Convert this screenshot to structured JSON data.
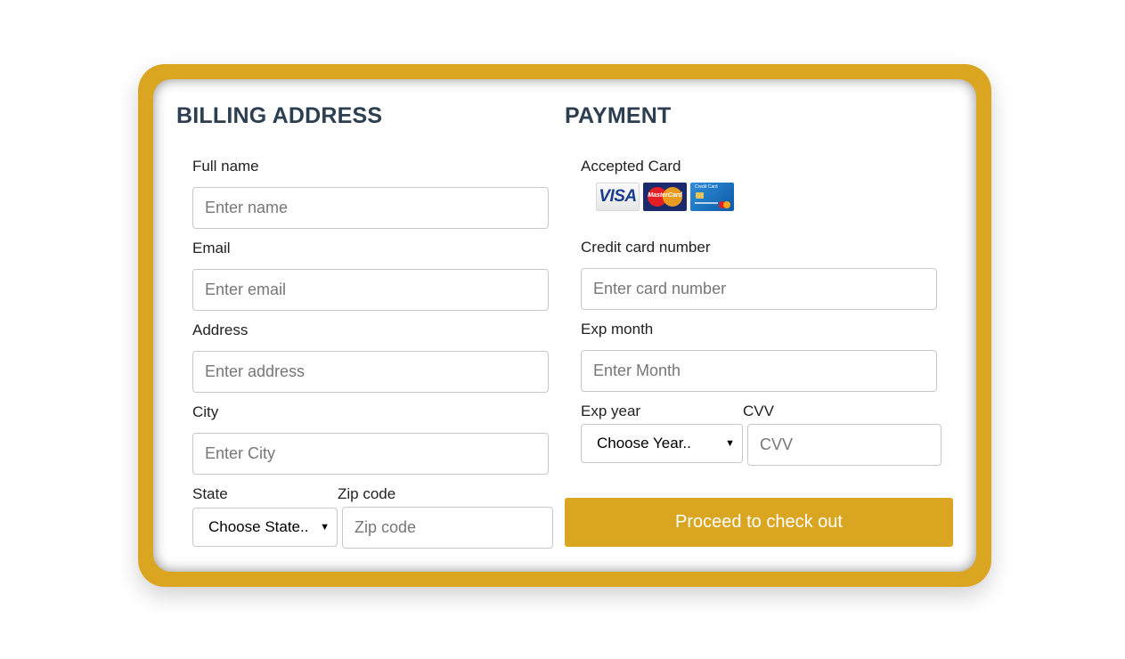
{
  "billing": {
    "heading": "BILLING ADDRESS",
    "full_name": {
      "label": "Full name",
      "placeholder": "Enter name",
      "value": ""
    },
    "email": {
      "label": "Email",
      "placeholder": "Enter email",
      "value": ""
    },
    "address": {
      "label": "Address",
      "placeholder": "Enter address",
      "value": ""
    },
    "city": {
      "label": "City",
      "placeholder": "Enter City",
      "value": ""
    },
    "state": {
      "label": "State",
      "selected": "Choose State.."
    },
    "zip": {
      "label": "Zip code",
      "placeholder": "Zip code",
      "value": ""
    }
  },
  "payment": {
    "heading": "PAYMENT",
    "accepted_label": "Accepted Card",
    "accepted_cards": [
      "visa-card-icon",
      "mastercard-icon",
      "generic-credit-card-icon"
    ],
    "visa_text": "VISA",
    "card_number": {
      "label": "Credit card number",
      "placeholder": "Enter card number",
      "value": ""
    },
    "exp_month": {
      "label": "Exp month",
      "placeholder": "Enter Month",
      "value": ""
    },
    "exp_year": {
      "label": "Exp year",
      "selected": "Choose Year.."
    },
    "cvv": {
      "label": "CVV",
      "placeholder": "CVV",
      "value": ""
    },
    "submit_label": "Proceed to check out"
  },
  "colors": {
    "accent": "#daa520",
    "heading": "#2c3e50"
  }
}
